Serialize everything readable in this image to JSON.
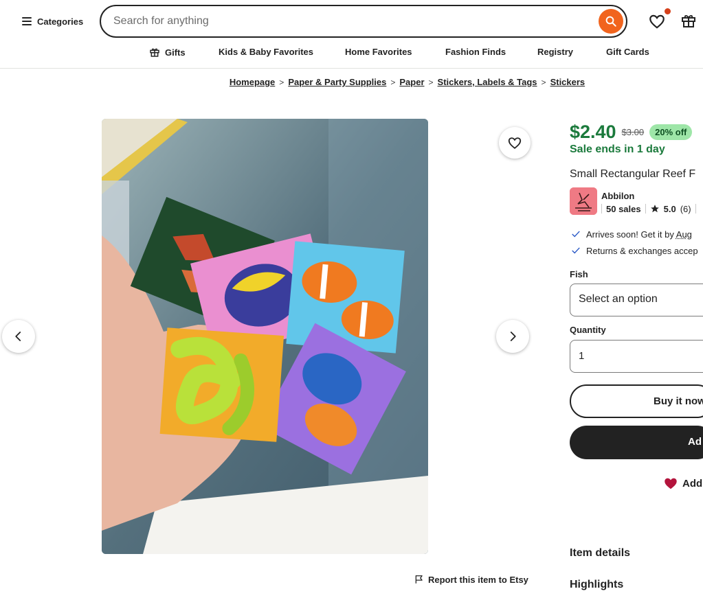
{
  "header": {
    "categories_label": "Categories",
    "search_placeholder": "Search for anything",
    "nav": [
      "Gifts",
      "Kids & Baby Favorites",
      "Home Favorites",
      "Fashion Finds",
      "Registry",
      "Gift Cards"
    ]
  },
  "breadcrumb": [
    "Homepage",
    "Paper & Party Supplies",
    "Paper",
    "Stickers, Labels & Tags",
    "Stickers"
  ],
  "product": {
    "price": "$2.40",
    "original_price": "$3.00",
    "discount": "20% off",
    "sale_ends": "Sale ends in 1 day",
    "title": "Small Rectangular Reef F",
    "shop": {
      "name": "Abbilon",
      "sales": "50 sales",
      "rating": "5.0",
      "reviews": "(6)"
    },
    "perks": {
      "arrives_prefix": "Arrives soon! Get it by ",
      "arrives_date": "Aug",
      "returns": "Returns & exchanges accep"
    },
    "options": {
      "fish_label": "Fish",
      "fish_value": "Select an option",
      "quantity_label": "Quantity",
      "quantity_value": "1"
    },
    "buttons": {
      "buy_now": "Buy it now",
      "add_to_cart": "Ad",
      "add_fav": "Add"
    },
    "sections": {
      "item_details": "Item details",
      "highlights": "Highlights"
    }
  },
  "gallery": {
    "report": "Report this item to Etsy"
  },
  "colors": {
    "accent": "#f1641e",
    "sale_green": "#1b7a3c",
    "badge_green": "#9ee6a8",
    "notify_dot": "#d5401a",
    "heart_red": "#b3143c"
  }
}
